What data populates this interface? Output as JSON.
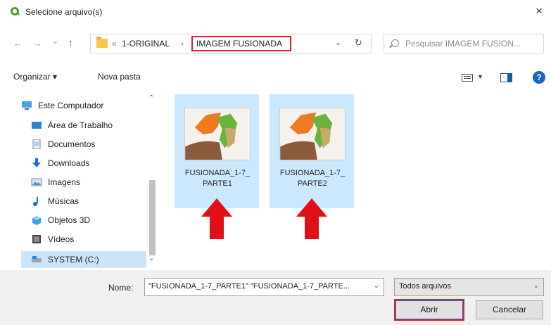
{
  "window": {
    "title": "Selecione arquivo(s)",
    "close_glyph": "×"
  },
  "nav": {
    "back": "←",
    "forward": "→",
    "recent": "⌄",
    "up": "↑"
  },
  "address": {
    "prefix": "«",
    "crumbs": [
      "1-ORIGINAL",
      "IMAGEM FUSIONADA"
    ],
    "separator": "›"
  },
  "search": {
    "placeholder": "Pesquisar IMAGEM FUSION..."
  },
  "toolbar": {
    "organize": "Organizar ▾",
    "new_folder": "Nova pasta"
  },
  "sidebar": {
    "items": [
      {
        "label": "Este Computador",
        "icon": "computer-icon"
      },
      {
        "label": "Área de Trabalho",
        "icon": "desktop-icon"
      },
      {
        "label": "Documentos",
        "icon": "document-icon"
      },
      {
        "label": "Downloads",
        "icon": "download-icon"
      },
      {
        "label": "Imagens",
        "icon": "pictures-icon"
      },
      {
        "label": "Músicas",
        "icon": "music-icon"
      },
      {
        "label": "Objetos 3D",
        "icon": "3d-objects-icon"
      },
      {
        "label": "Vídeos",
        "icon": "video-icon"
      },
      {
        "label": "SYSTEM (C:)",
        "icon": "drive-icon"
      }
    ]
  },
  "files": [
    {
      "label_line1": "FUSIONADA_1-7_",
      "label_line2": "PARTE1"
    },
    {
      "label_line1": "FUSIONADA_1-7_",
      "label_line2": "PARTE2"
    }
  ],
  "footer": {
    "name_label": "Nome:",
    "name_value": "\"FUSIONADA_1-7_PARTE1\" \"FUSIONADA_1-7_PARTE...",
    "type_value": "Todos arquivos",
    "open_button": "Abrir",
    "cancel_button": "Cancelar"
  },
  "colors": {
    "highlight_red": "#e0202a",
    "selection_blue": "#cce8ff",
    "arrow_red": "#e0101a"
  }
}
